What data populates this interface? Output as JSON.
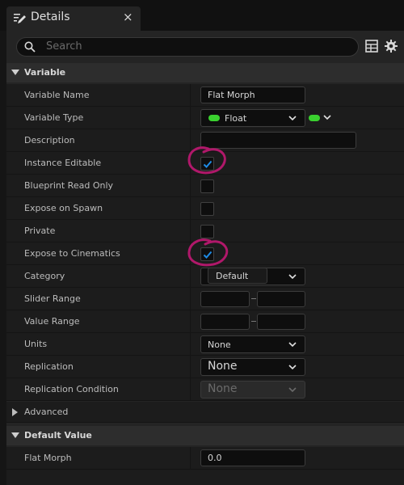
{
  "tab": {
    "title": "Details",
    "close": "×",
    "icon": "pencil-details-icon"
  },
  "search": {
    "placeholder": "Search"
  },
  "toolbar": {
    "table_icon": "table-view-icon",
    "settings_icon": "gear-icon"
  },
  "sections": {
    "variable": "Variable",
    "advanced": "Advanced",
    "default_value": "Default Value"
  },
  "rows": {
    "variable_name": {
      "label": "Variable Name",
      "value": "Flat Morph"
    },
    "variable_type": {
      "label": "Variable Type",
      "value": "Float",
      "pin_color": "#3ad12f"
    },
    "description": {
      "label": "Description",
      "value": ""
    },
    "instance_editable": {
      "label": "Instance Editable",
      "checked": true
    },
    "blueprint_read_only": {
      "label": "Blueprint Read Only",
      "checked": false
    },
    "expose_on_spawn": {
      "label": "Expose on Spawn",
      "checked": false
    },
    "private": {
      "label": "Private",
      "checked": false
    },
    "expose_to_cinematics": {
      "label": "Expose to Cinematics",
      "checked": true
    },
    "category": {
      "label": "Category",
      "value": "Default"
    },
    "slider_range": {
      "label": "Slider Range",
      "min": "",
      "max": ""
    },
    "value_range": {
      "label": "Value Range",
      "min": "",
      "max": ""
    },
    "units": {
      "label": "Units",
      "value": "None"
    },
    "replication": {
      "label": "Replication",
      "value": "None"
    },
    "replication_condition": {
      "label": "Replication Condition",
      "value": "None"
    },
    "flat_morph_default": {
      "label": "Flat Morph",
      "value": "0.0"
    }
  },
  "colors": {
    "accent_check": "#1e8ce6",
    "annotation": "#b0186a",
    "float_pin": "#3ad12f"
  }
}
